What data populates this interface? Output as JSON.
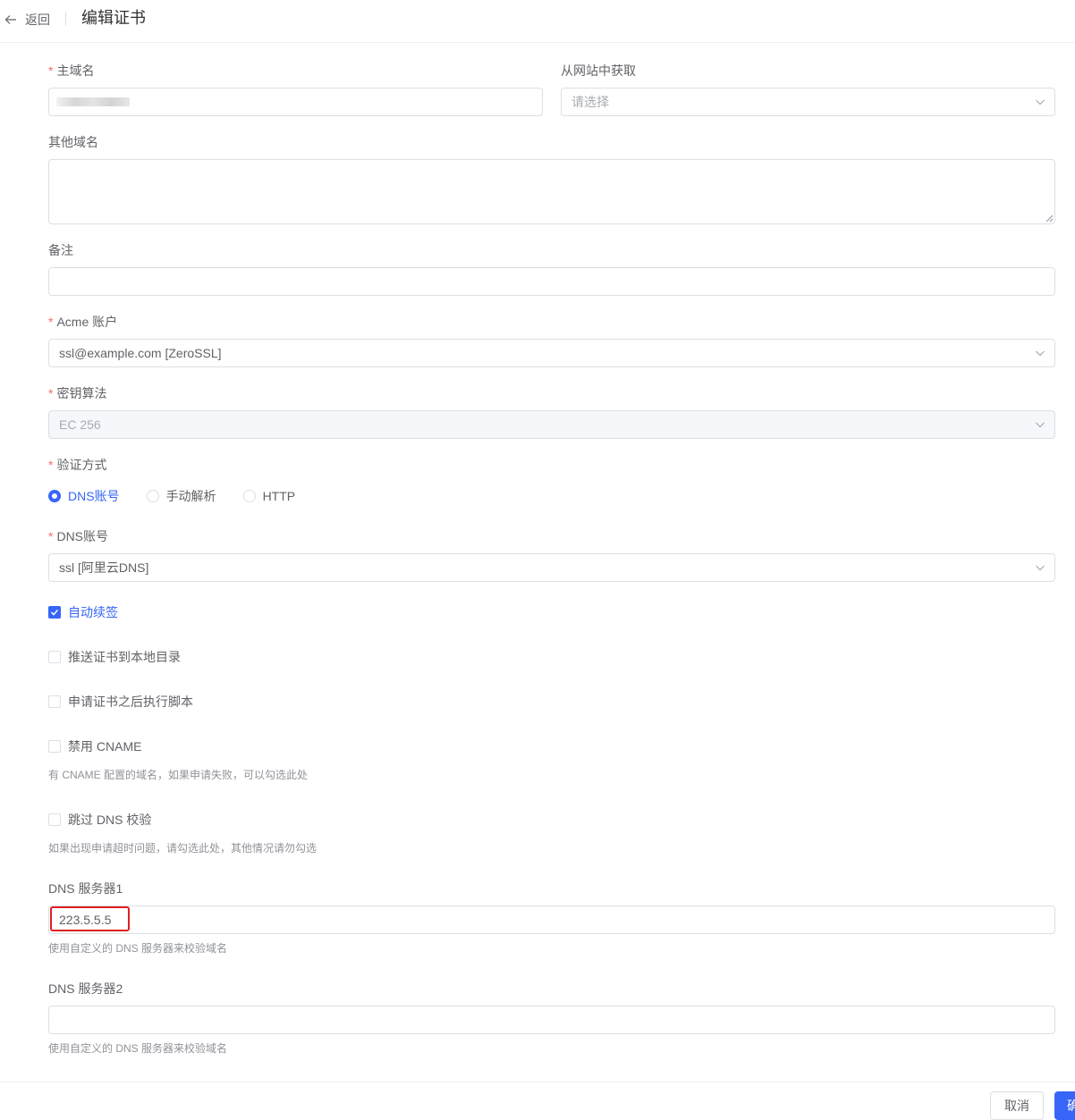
{
  "header": {
    "back_label": "返回",
    "title": "编辑证书"
  },
  "colors": {
    "primary": "#3665f7",
    "required": "#f56c6c",
    "highlight": "#e02020"
  },
  "form": {
    "main_domain": {
      "label": "主域名",
      "required": true,
      "value": ""
    },
    "from_site": {
      "label": "从网站中获取",
      "placeholder": "请选择"
    },
    "other_domains": {
      "label": "其他域名",
      "value": ""
    },
    "remark": {
      "label": "备注",
      "value": ""
    },
    "acme_account": {
      "label": "Acme 账户",
      "required": true,
      "value": "ssl@example.com [ZeroSSL]"
    },
    "key_algorithm": {
      "label": "密钥算法",
      "required": true,
      "value": "EC 256",
      "disabled": true
    },
    "verify_method": {
      "label": "验证方式",
      "required": true,
      "options": [
        "DNS账号",
        "手动解析",
        "HTTP"
      ],
      "selected": "DNS账号"
    },
    "dns_account": {
      "label": "DNS账号",
      "required": true,
      "value": "ssl [阿里云DNS]"
    },
    "auto_renew": {
      "label": "自动续签",
      "checked": true
    },
    "push_local": {
      "label": "推送证书到本地目录",
      "checked": false
    },
    "post_script": {
      "label": "申请证书之后执行脚本",
      "checked": false
    },
    "disable_cname": {
      "label": "禁用 CNAME",
      "checked": false,
      "hint": "有 CNAME 配置的域名，如果申请失败，可以勾选此处"
    },
    "skip_dns_check": {
      "label": "跳过 DNS 校验",
      "checked": false,
      "hint": "如果出现申请超时问题，请勾选此处，其他情况请勿勾选"
    },
    "dns_server1": {
      "label": "DNS 服务器1",
      "value": "223.5.5.5",
      "hint": "使用自定义的 DNS 服务器来校验域名"
    },
    "dns_server2": {
      "label": "DNS 服务器2",
      "value": "",
      "hint": "使用自定义的 DNS 服务器来校验域名"
    }
  },
  "footer": {
    "cancel_label": "取消",
    "confirm_label": "确"
  }
}
